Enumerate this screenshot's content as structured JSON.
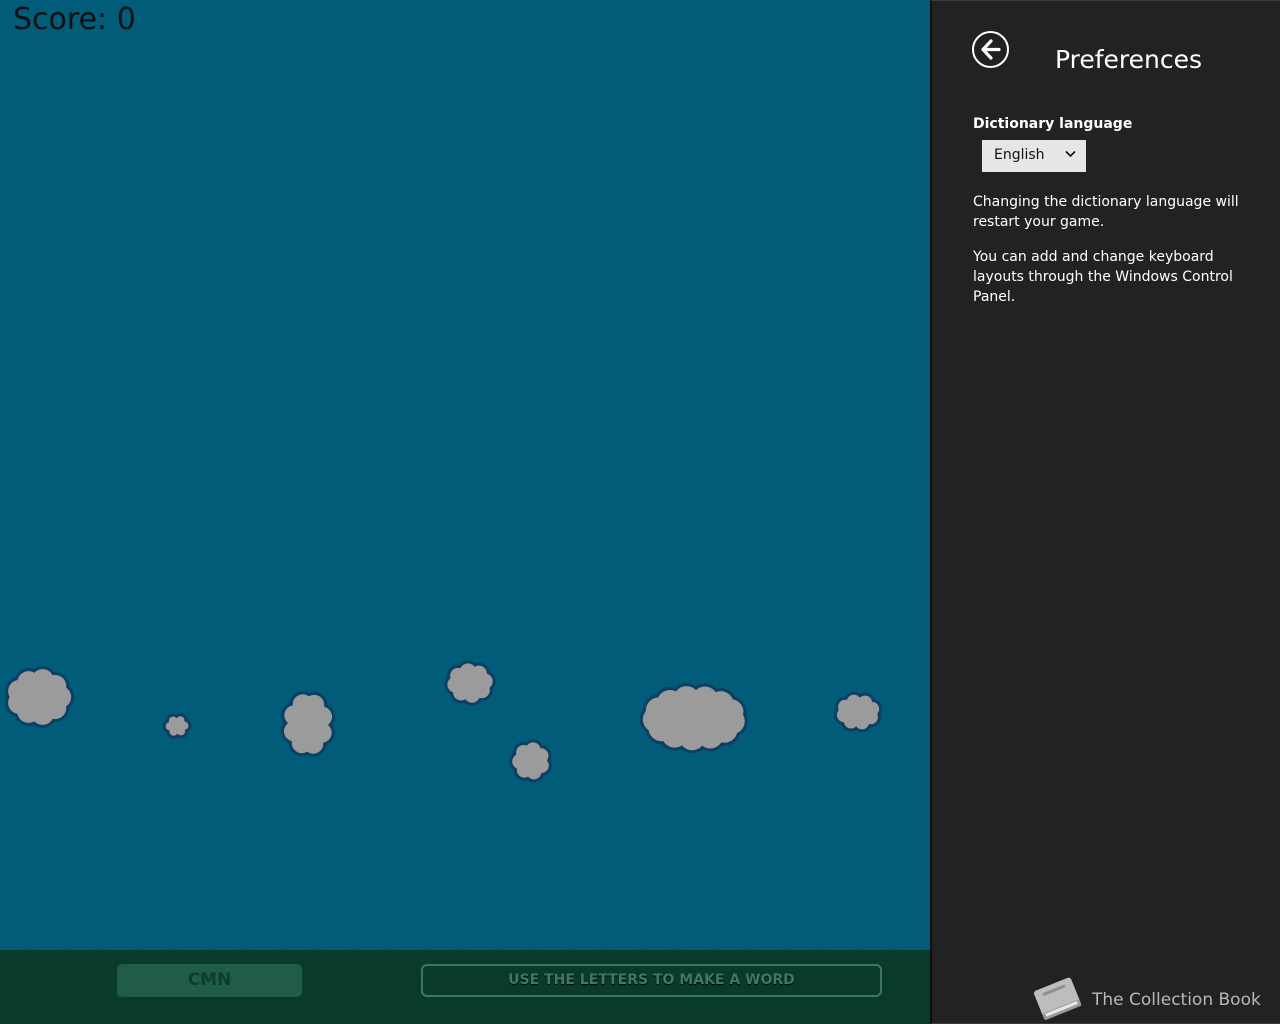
{
  "game": {
    "score_label": "Score:",
    "score_value": "0",
    "letters": "CMN",
    "word_hint": "USE THE LETTERS TO MAKE A WORD",
    "colors": {
      "sky": "#005c78",
      "cloud_fill": "#9b9b9b",
      "cloud_outline": "#0d3f62",
      "ground": "#0a3a2a"
    }
  },
  "preferences": {
    "back_icon": "back-arrow-icon",
    "title": "Preferences",
    "dictionary_label": "Dictionary language",
    "language_selected": "English",
    "note_restart": "Changing the dictionary language will restart your game.",
    "note_keyboard": "You can add and change keyboard layouts through the Windows Control Panel.",
    "app_icon": "book-icon",
    "app_name": "The Collection Book"
  }
}
